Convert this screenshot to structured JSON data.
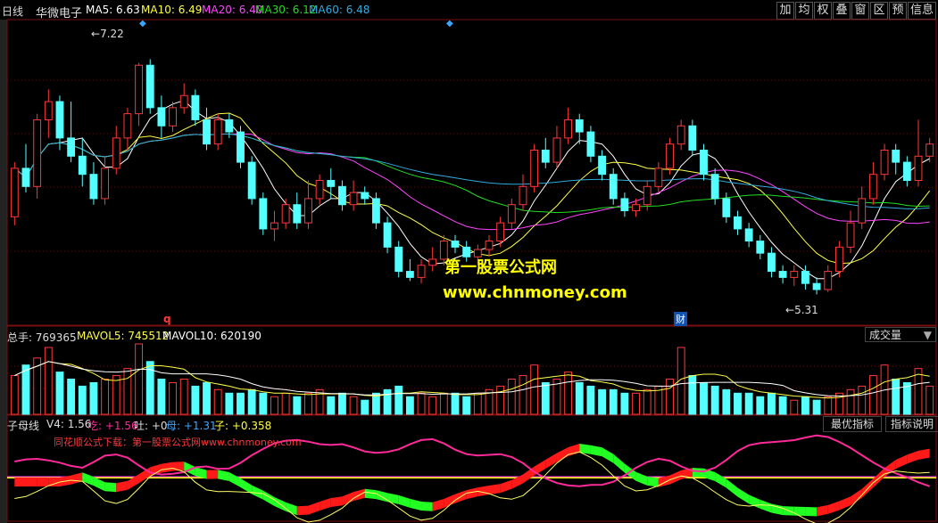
{
  "header": {
    "period": "日线",
    "stock_name": "华微电子",
    "ma5": "MA5: 6.63",
    "ma10": "MA10: 6.49",
    "ma20": "MA20: 6.40",
    "ma30": "MA30: 6.12",
    "ma60": "MA60: 6.48"
  },
  "toolbar": [
    "加",
    "均",
    "权",
    "叠",
    "窗",
    "区",
    "预",
    "信息"
  ],
  "price_annotations": {
    "high_label": "7.22",
    "low_label": "5.31",
    "marker_q": "q",
    "marker_cai": "财"
  },
  "watermark": {
    "line1": "第一股票公式网",
    "line2": "www.chnmoney.com"
  },
  "volume_header": {
    "total": "总手: 769365",
    "mavol5": "MAVOL5: 745512",
    "mavol10": "MAVOL10: 620190",
    "select_label": "成交量"
  },
  "indicator_header": {
    "name": "子母线",
    "v4": "V4: 1.56",
    "chi": "吃: +1.56",
    "tu": "吐: +0",
    "mu": "母: +1.31",
    "zi": "子: +0.358",
    "best_button": "最优指标",
    "explain_button": "指标说明",
    "note": "同花顺公式下载：第一股票公式网www.chnmoney.com"
  },
  "colors": {
    "up": "#ff3838",
    "down": "#54ffff",
    "ma5": "#ffffff",
    "ma10": "#ffff44",
    "ma20": "#ff44ff",
    "ma30": "#22dd22",
    "ma60": "#33aadd",
    "watermark": "#ffff00",
    "indicator_line_pink": "#ff2a9a",
    "indicator_line_yellow": "#ffff66",
    "indicator_fill_red": "#ff1a1a",
    "indicator_fill_green": "#22ff22",
    "ref_line_yellow": "#ffff00",
    "ref_line_pink": "#ff2aff"
  },
  "chart_data": {
    "type": "candlestick",
    "price_range": [
      5.1,
      7.4
    ],
    "candles": [
      [
        5.95,
        6.35,
        5.88,
        6.4
      ],
      [
        6.35,
        6.2,
        6.15,
        6.55
      ],
      [
        6.2,
        6.75,
        6.1,
        6.8
      ],
      [
        6.75,
        6.9,
        6.6,
        7.0
      ],
      [
        6.9,
        6.6,
        6.5,
        6.95
      ],
      [
        6.6,
        6.45,
        6.4,
        6.9
      ],
      [
        6.45,
        6.3,
        6.2,
        6.6
      ],
      [
        6.3,
        6.1,
        6.05,
        6.4
      ],
      [
        6.1,
        6.35,
        6.05,
        6.45
      ],
      [
        6.35,
        6.6,
        6.3,
        6.7
      ],
      [
        6.6,
        6.8,
        6.5,
        6.85
      ],
      [
        6.8,
        7.2,
        6.7,
        7.22
      ],
      [
        7.2,
        6.85,
        6.8,
        7.25
      ],
      [
        6.85,
        6.7,
        6.6,
        6.95
      ],
      [
        6.7,
        6.85,
        6.65,
        6.9
      ],
      [
        6.85,
        6.95,
        6.8,
        7.05
      ],
      [
        6.95,
        6.75,
        6.7,
        7.0
      ],
      [
        6.75,
        6.55,
        6.5,
        6.85
      ],
      [
        6.55,
        6.75,
        6.5,
        6.8
      ],
      [
        6.75,
        6.65,
        6.6,
        6.8
      ],
      [
        6.65,
        6.4,
        6.35,
        6.7
      ],
      [
        6.4,
        6.1,
        6.05,
        6.45
      ],
      [
        6.1,
        5.85,
        5.8,
        6.15
      ],
      [
        5.85,
        5.9,
        5.75,
        6.0
      ],
      [
        5.9,
        6.05,
        5.85,
        6.1
      ],
      [
        6.05,
        5.9,
        5.85,
        6.15
      ],
      [
        5.9,
        6.1,
        5.85,
        6.25
      ],
      [
        6.1,
        6.25,
        6.05,
        6.3
      ],
      [
        6.25,
        6.2,
        6.1,
        6.35
      ],
      [
        6.2,
        6.05,
        6.0,
        6.25
      ],
      [
        6.05,
        6.15,
        6.0,
        6.25
      ],
      [
        6.15,
        6.1,
        6.05,
        6.2
      ],
      [
        6.1,
        5.9,
        5.85,
        6.15
      ],
      [
        5.9,
        5.7,
        5.65,
        5.95
      ],
      [
        5.7,
        5.5,
        5.45,
        5.75
      ],
      [
        5.5,
        5.45,
        5.42,
        5.6
      ],
      [
        5.45,
        5.55,
        5.4,
        5.6
      ],
      [
        5.55,
        5.6,
        5.5,
        5.7
      ],
      [
        5.6,
        5.75,
        5.55,
        5.8
      ],
      [
        5.75,
        5.7,
        5.65,
        5.8
      ],
      [
        5.7,
        5.62,
        5.58,
        5.75
      ],
      [
        5.62,
        5.68,
        5.55,
        5.72
      ],
      [
        5.68,
        5.75,
        5.62,
        5.8
      ],
      [
        5.75,
        5.9,
        5.7,
        5.95
      ],
      [
        5.9,
        6.05,
        5.85,
        6.1
      ],
      [
        6.05,
        6.2,
        6.0,
        6.3
      ],
      [
        6.2,
        6.5,
        6.15,
        6.55
      ],
      [
        6.5,
        6.4,
        6.35,
        6.6
      ],
      [
        6.4,
        6.6,
        6.35,
        6.7
      ],
      [
        6.6,
        6.75,
        6.55,
        6.85
      ],
      [
        6.75,
        6.65,
        6.55,
        6.8
      ],
      [
        6.65,
        6.45,
        6.4,
        6.7
      ],
      [
        6.45,
        6.3,
        6.25,
        6.5
      ],
      [
        6.3,
        6.1,
        6.05,
        6.35
      ],
      [
        6.1,
        6.0,
        5.95,
        6.15
      ],
      [
        6.0,
        6.05,
        5.95,
        6.1
      ],
      [
        6.05,
        6.2,
        6.0,
        6.25
      ],
      [
        6.2,
        6.35,
        6.15,
        6.4
      ],
      [
        6.35,
        6.55,
        6.3,
        6.6
      ],
      [
        6.55,
        6.7,
        6.5,
        6.75
      ],
      [
        6.7,
        6.5,
        6.45,
        6.75
      ],
      [
        6.5,
        6.3,
        6.25,
        6.55
      ],
      [
        6.3,
        6.1,
        6.05,
        6.35
      ],
      [
        6.1,
        5.95,
        5.9,
        6.15
      ],
      [
        5.95,
        5.85,
        5.8,
        6.0
      ],
      [
        5.85,
        5.75,
        5.7,
        5.9
      ],
      [
        5.75,
        5.65,
        5.6,
        5.8
      ],
      [
        5.65,
        5.5,
        5.45,
        5.7
      ],
      [
        5.5,
        5.45,
        5.4,
        5.55
      ],
      [
        5.45,
        5.5,
        5.38,
        5.55
      ],
      [
        5.5,
        5.4,
        5.35,
        5.55
      ],
      [
        5.4,
        5.35,
        5.31,
        5.45
      ],
      [
        5.35,
        5.5,
        5.33,
        5.55
      ],
      [
        5.5,
        5.7,
        5.45,
        5.75
      ],
      [
        5.7,
        5.9,
        5.65,
        6.0
      ],
      [
        5.9,
        6.1,
        5.85,
        6.2
      ],
      [
        6.1,
        6.3,
        6.05,
        6.4
      ],
      [
        6.3,
        6.5,
        6.25,
        6.55
      ],
      [
        6.5,
        6.4,
        6.3,
        6.55
      ],
      [
        6.4,
        6.25,
        6.2,
        6.45
      ],
      [
        6.25,
        6.45,
        6.2,
        6.75
      ],
      [
        6.45,
        6.55,
        6.4,
        6.6
      ]
    ],
    "volumes": [
      0.55,
      0.7,
      0.8,
      0.95,
      0.6,
      0.5,
      0.4,
      0.45,
      0.5,
      0.55,
      0.65,
      1.0,
      0.75,
      0.5,
      0.45,
      0.5,
      0.4,
      0.45,
      0.35,
      0.3,
      0.3,
      0.35,
      0.3,
      0.25,
      0.3,
      0.25,
      0.3,
      0.35,
      0.25,
      0.3,
      0.25,
      0.2,
      0.3,
      0.35,
      0.4,
      0.25,
      0.3,
      0.25,
      0.3,
      0.3,
      0.25,
      0.3,
      0.35,
      0.4,
      0.5,
      0.55,
      0.7,
      0.45,
      0.5,
      0.6,
      0.45,
      0.4,
      0.35,
      0.35,
      0.3,
      0.3,
      0.35,
      0.4,
      0.5,
      0.95,
      0.55,
      0.45,
      0.4,
      0.35,
      0.3,
      0.3,
      0.25,
      0.3,
      0.25,
      0.2,
      0.25,
      0.2,
      0.25,
      0.3,
      0.35,
      0.4,
      0.55,
      0.7,
      0.5,
      0.45,
      0.65,
      0.4
    ]
  }
}
